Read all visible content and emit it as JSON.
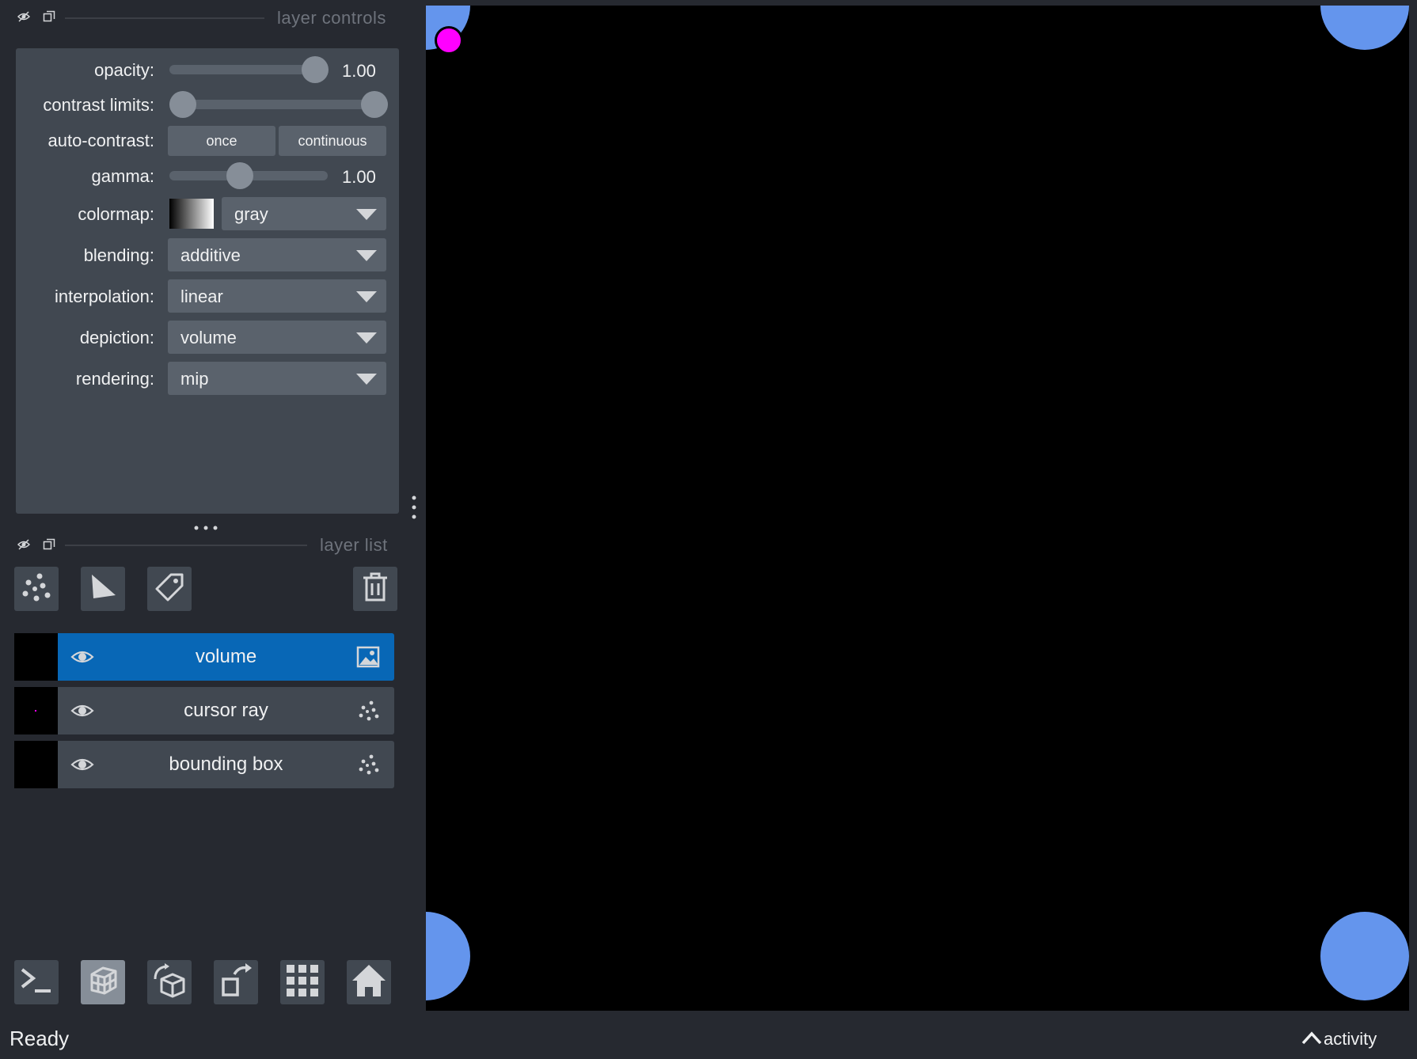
{
  "layer_controls": {
    "title": "layer controls",
    "opacity": {
      "label": "opacity:",
      "value": 1.0,
      "value_text": "1.00"
    },
    "contrast_limits": {
      "label": "contrast limits:",
      "low": 0.0,
      "high": 1.0
    },
    "auto_contrast": {
      "label": "auto-contrast:",
      "once": "once",
      "continuous": "continuous"
    },
    "gamma": {
      "label": "gamma:",
      "value": 1.0,
      "value_text": "1.00",
      "min": 0.2,
      "max": 2.0
    },
    "colormap": {
      "label": "colormap:",
      "value": "gray"
    },
    "blending": {
      "label": "blending:",
      "value": "additive"
    },
    "interpolation": {
      "label": "interpolation:",
      "value": "linear"
    },
    "depiction": {
      "label": "depiction:",
      "value": "volume"
    },
    "rendering": {
      "label": "rendering:",
      "value": "mip"
    }
  },
  "layer_list": {
    "title": "layer list",
    "toolbar": [
      "new-points-layer-icon",
      "new-shapes-layer-icon",
      "new-labels-layer-icon",
      "delete-layer-icon"
    ],
    "layers": [
      {
        "name": "volume",
        "visible": true,
        "selected": true,
        "type_icon": "image-icon"
      },
      {
        "name": "cursor ray",
        "visible": true,
        "selected": false,
        "type_icon": "points-icon"
      },
      {
        "name": "bounding box",
        "visible": true,
        "selected": false,
        "type_icon": "points-icon"
      }
    ]
  },
  "bottom_bar": [
    "console-icon",
    "ndisplay-3d-icon",
    "roll-dims-icon",
    "transpose-dims-icon",
    "grid-view-icon",
    "home-icon"
  ],
  "canvas": {
    "background": "#000000",
    "corner_point_color": "#6495ed",
    "cursor_point_color": "#ff00ff"
  },
  "status": {
    "text": "Ready",
    "activity": "activity"
  },
  "colors": {
    "panel": "#262930",
    "widget": "#414851",
    "selected": "#0867b6",
    "foreground": "#5a626c"
  }
}
